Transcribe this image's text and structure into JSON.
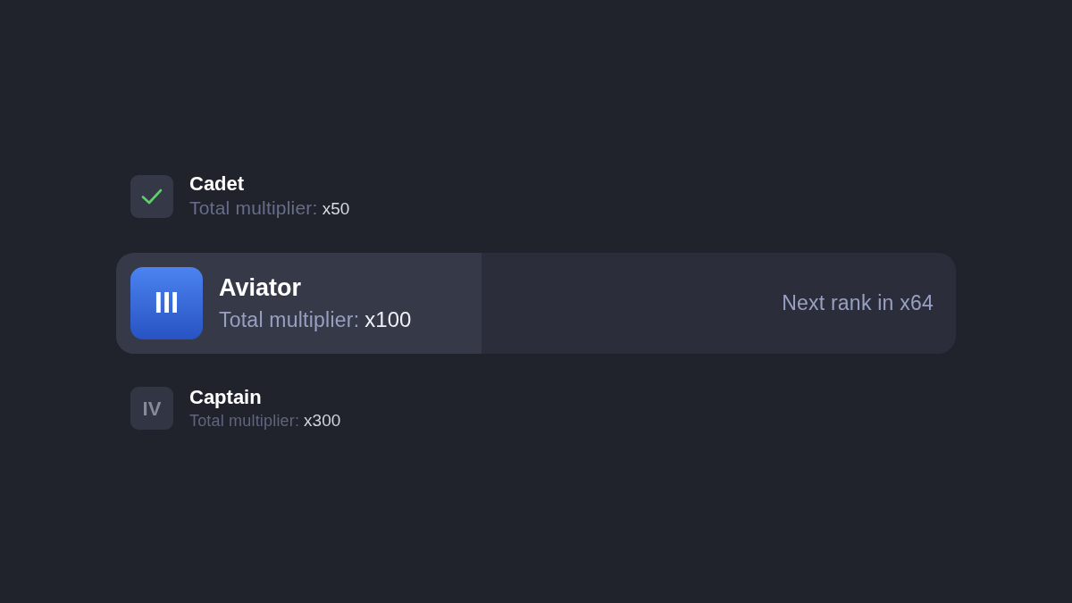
{
  "ranks": [
    {
      "kind": "completed",
      "name": "Cadet",
      "multiplier_label": "Total multiplier:",
      "multiplier": "x50"
    },
    {
      "kind": "current",
      "badge": "III",
      "name": "Aviator",
      "multiplier_label": "Total multiplier:",
      "multiplier": "x100",
      "level": 0.435,
      "next_rank": "Next rank in x64"
    },
    {
      "kind": "locked",
      "badge": "IV",
      "name": "Captain",
      "multiplier_label": "Total multiplier:",
      "multiplier": "x300"
    }
  ]
}
